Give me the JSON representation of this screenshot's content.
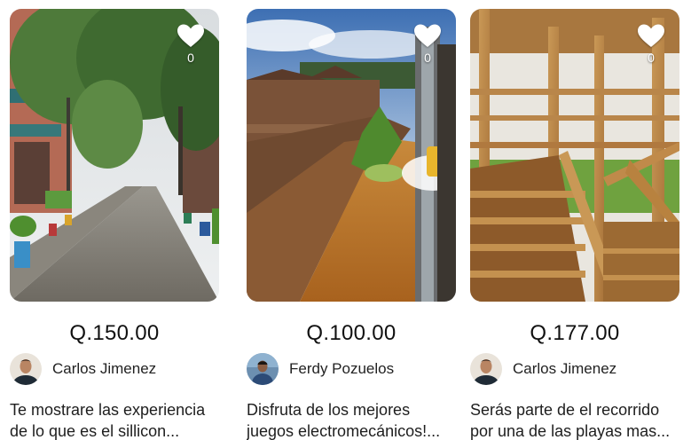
{
  "listings": [
    {
      "likes": "0",
      "price": "Q.150.00",
      "seller": "Carlos Jimenez",
      "description_lines": [
        "Te mostrare las experiencia",
        "de lo que es el sillicon..."
      ]
    },
    {
      "likes": "0",
      "price": "Q.100.00",
      "seller": "Ferdy Pozuelos",
      "description_lines": [
        "Disfruta de los mejores",
        "juegos electromecánicos!..."
      ]
    },
    {
      "likes": "0",
      "price": "Q.177.00",
      "seller": "Carlos Jimenez",
      "description_lines": [
        "Serás parte de el recorrido",
        "por una de las playas mas..."
      ]
    }
  ],
  "icons": {
    "like": "heart-icon"
  },
  "colors": {
    "heart": "#ffffff",
    "price_text": "#111111"
  }
}
